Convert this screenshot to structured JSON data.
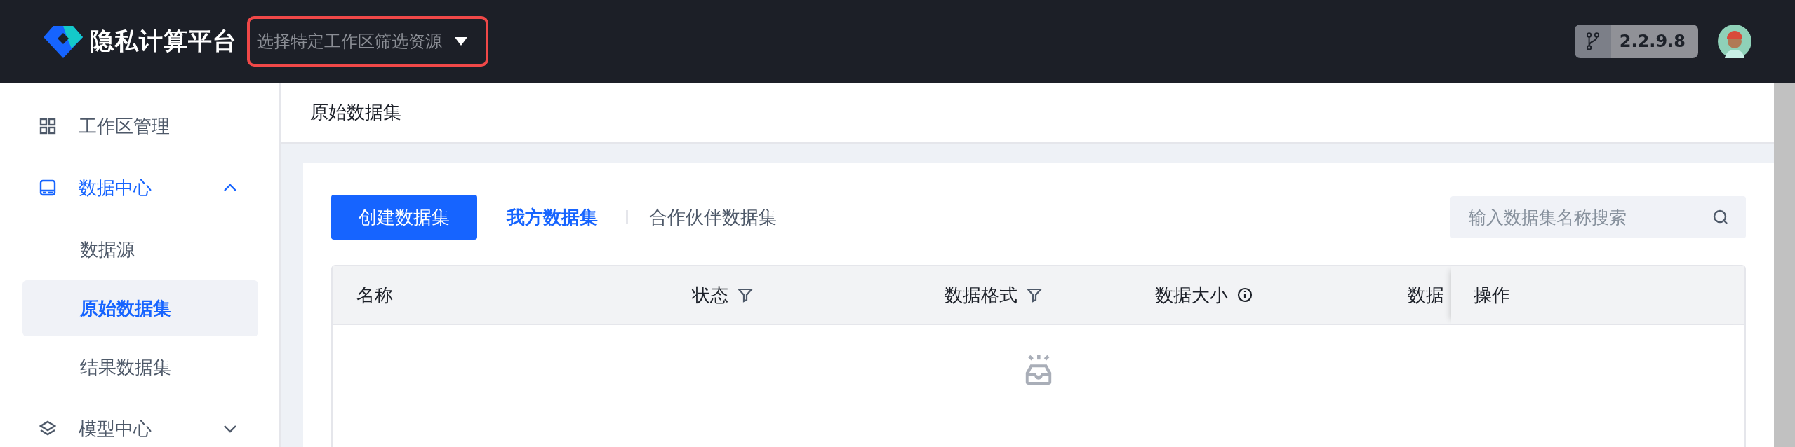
{
  "header": {
    "logo_text": "隐私计算平台",
    "workspace_select": {
      "placeholder": "选择特定工作区筛选资源"
    },
    "version": "2.2.9.8"
  },
  "sidebar": {
    "items": [
      {
        "label": "工作区管理",
        "kind": "link",
        "selected": false
      },
      {
        "label": "数据中心",
        "kind": "group",
        "expanded": true,
        "children": [
          {
            "label": "数据源",
            "selected": false
          },
          {
            "label": "原始数据集",
            "selected": true
          },
          {
            "label": "结果数据集",
            "selected": false
          }
        ]
      },
      {
        "label": "模型中心",
        "kind": "group",
        "expanded": false
      }
    ]
  },
  "page_title": "原始数据集",
  "toolbar": {
    "create_button": "创建数据集",
    "tabs": [
      {
        "label": "我方数据集",
        "selected": true
      },
      {
        "label": "合作伙伴数据集",
        "selected": false
      }
    ],
    "search": {
      "placeholder": "输入数据集名称搜索"
    }
  },
  "table": {
    "columns": [
      {
        "label": "名称",
        "kind": "plain"
      },
      {
        "label": "状态",
        "kind": "filterable"
      },
      {
        "label": "数据格式",
        "kind": "filterable"
      },
      {
        "label": "数据大小",
        "kind": "explained"
      },
      {
        "label": "数据",
        "kind": "plain"
      }
    ],
    "action_column": "操作",
    "empty": true
  }
}
